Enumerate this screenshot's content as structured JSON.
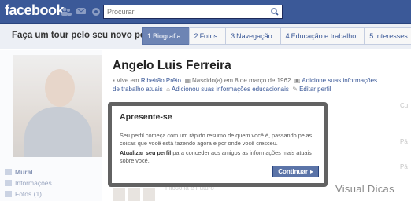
{
  "topbar": {
    "logo": "facebook",
    "search_placeholder": "Procurar"
  },
  "tour": {
    "title": "Faça um tour pelo seu novo perfil",
    "steps": [
      {
        "num": "1",
        "label": "Biografia"
      },
      {
        "num": "2",
        "label": "Fotos"
      },
      {
        "num": "3",
        "label": "Navegação"
      },
      {
        "num": "4",
        "label": "Educação e trabalho"
      },
      {
        "num": "5",
        "label": "Interesses"
      }
    ]
  },
  "profile": {
    "name": "Angelo Luis Ferreira",
    "lives_prefix": "Vive em",
    "city": "Ribeirão Prêto",
    "born": "Nascido(a) em 8 de março de 1962",
    "add_work_a": "Adicione suas informações de",
    "add_work_b": "trabalho atuais",
    "add_edu": "Adicionou suas informações educacionais",
    "edit_profile": "Editar perfil"
  },
  "sidebar": {
    "items": [
      {
        "label": "Mural"
      },
      {
        "label": "Informações"
      },
      {
        "label": "Fotos (1)"
      }
    ]
  },
  "modal": {
    "title": "Apresente-se",
    "para1": "Seu perfil começa com um rápido resumo de quem você é, passando pelas coisas que você está fazendo agora e por onde você cresceu.",
    "para2_bold": "Atualizar seu perfil",
    "para2_rest": "para conceder aos amigos as informações mais atuais sobre você.",
    "continue": "Continuar"
  },
  "background": {
    "right1": "Cu",
    "right2": "Pá",
    "right3": "Pá",
    "friends_text": "Filosofia e Futuro"
  },
  "watermark": "Visual Dicas",
  "colors": {
    "brand": "#3b5998",
    "tour_active": "#6d84b4",
    "modal_border": "#464646"
  }
}
